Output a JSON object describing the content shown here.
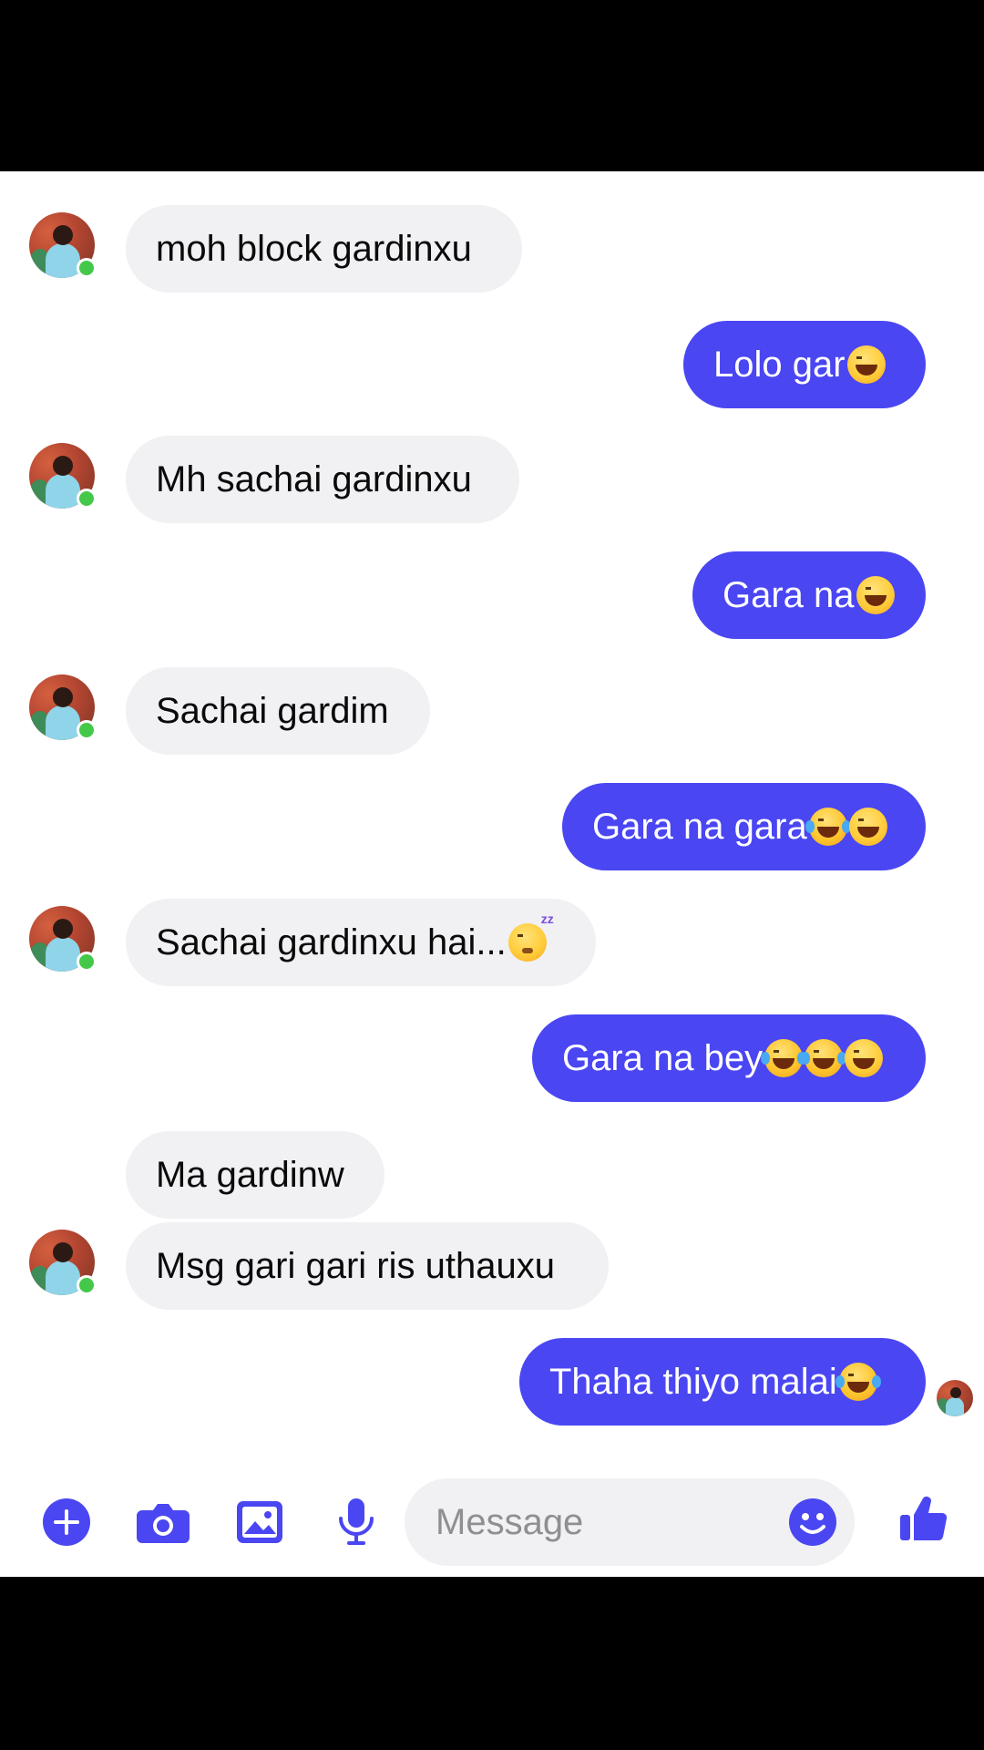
{
  "messages": [
    {
      "side": "in",
      "text": "moh block gardinxu",
      "emojis": [],
      "avatar": true
    },
    {
      "side": "out",
      "text": "Lolo gar",
      "emojis": [
        "grin-squint"
      ]
    },
    {
      "side": "in",
      "text": "Mh sachai gardinxu",
      "emojis": [],
      "avatar": true
    },
    {
      "side": "out",
      "text": "Gara na",
      "emojis": [
        "grin-squint"
      ]
    },
    {
      "side": "in",
      "text": "Sachai gardim",
      "emojis": [],
      "avatar": true
    },
    {
      "side": "out",
      "text": "Gara na gara",
      "emojis": [
        "tears-of-joy",
        "grin-squint"
      ]
    },
    {
      "side": "in",
      "text": "Sachai gardinxu hai...",
      "emojis": [
        "sleepy-face"
      ],
      "avatar": true
    },
    {
      "side": "out",
      "text": "Gara na bey",
      "emojis": [
        "tears-of-joy",
        "tears-of-joy",
        "grin-squint"
      ]
    },
    {
      "side": "in",
      "text": "Ma gardinw",
      "emojis": [],
      "avatar": false
    },
    {
      "side": "in",
      "text": "Msg gari gari ris uthauxu",
      "emojis": [],
      "avatar": true
    },
    {
      "side": "out",
      "text": "Thaha thiyo malai",
      "emojis": [
        "tears-of-joy"
      ],
      "seen": true
    }
  ],
  "composer": {
    "placeholder": "Message",
    "icons": [
      "plus-icon",
      "camera-icon",
      "image-icon",
      "microphone-icon",
      "emoji-icon",
      "thumbs-up-icon"
    ]
  },
  "colors": {
    "accent": "#4a46f2",
    "incoming_bubble": "#f1f0f3",
    "online": "#44c84a",
    "background": "#ffffff"
  }
}
